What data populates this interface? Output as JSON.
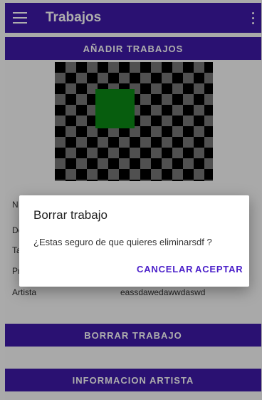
{
  "appbar": {
    "title": "Trabajos"
  },
  "buttons": {
    "add_label": "AÑADIR TRABAJOS",
    "delete_label": "BORRAR TRABAJO",
    "info_label": "INFORMACION ARTISTA"
  },
  "details": [
    {
      "label": "N",
      "value": ""
    },
    {
      "label": "De",
      "value": ""
    },
    {
      "label": "Ta",
      "value": ""
    },
    {
      "label": "Pr",
      "value": ""
    },
    {
      "label": "Artista",
      "value": "eassdawedawwdaswd"
    }
  ],
  "dialog": {
    "title": "Borrar trabajo",
    "message": "¿Estas seguro de que quieres eliminarsdf ?",
    "cancel_label": "CANCELAR",
    "accept_label": "ACEPTAR"
  },
  "colors": {
    "primary": "#3f1aa8",
    "accent_text": "#4a1fc9",
    "preview_square": "#0b8a16"
  }
}
